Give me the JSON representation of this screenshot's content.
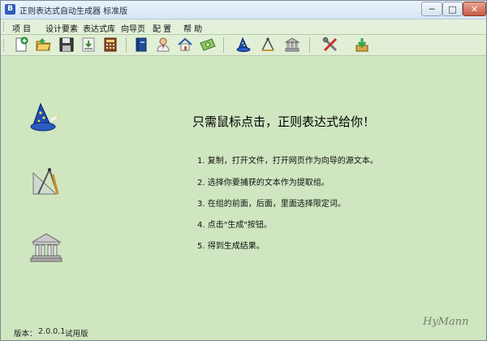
{
  "window": {
    "title": "正则表达式自动生成器 标准版",
    "app_icon_glyph": "B",
    "minimize_glyph": "─",
    "maximize_glyph": "□",
    "close_glyph": "✕"
  },
  "menu": {
    "items": [
      "项 目",
      "设计要素",
      "表达式库",
      "向导页",
      "配 置",
      "帮 助"
    ]
  },
  "toolbar": {
    "icons": [
      "new-file-icon",
      "open-folder-icon",
      "save-icon",
      "import-icon",
      "calculator-icon",
      "book-icon",
      "user-icon",
      "home-icon",
      "money-icon",
      "wizard-hat-icon",
      "compass-icon",
      "library-icon",
      "tools-icon",
      "download-icon"
    ]
  },
  "main": {
    "headline": "只需鼠标点击，正则表达式给你！",
    "steps": [
      "1. 复制，打开文件，打开网页作为向导的源文本。",
      "2. 选择你要捕获的文本作为提取组。",
      "3. 在组的前面，后面，里面选择限定词。",
      "4. 点击\"生成\"按钮。",
      "5. 得到生成结果。"
    ]
  },
  "status": {
    "version_label": "版本：",
    "version_value": "2.0.0.1",
    "edition": "试用版"
  },
  "colors": {
    "background": "#cfe6c0",
    "toolbar": "#e1efd6",
    "close_button": "#c75a42"
  }
}
